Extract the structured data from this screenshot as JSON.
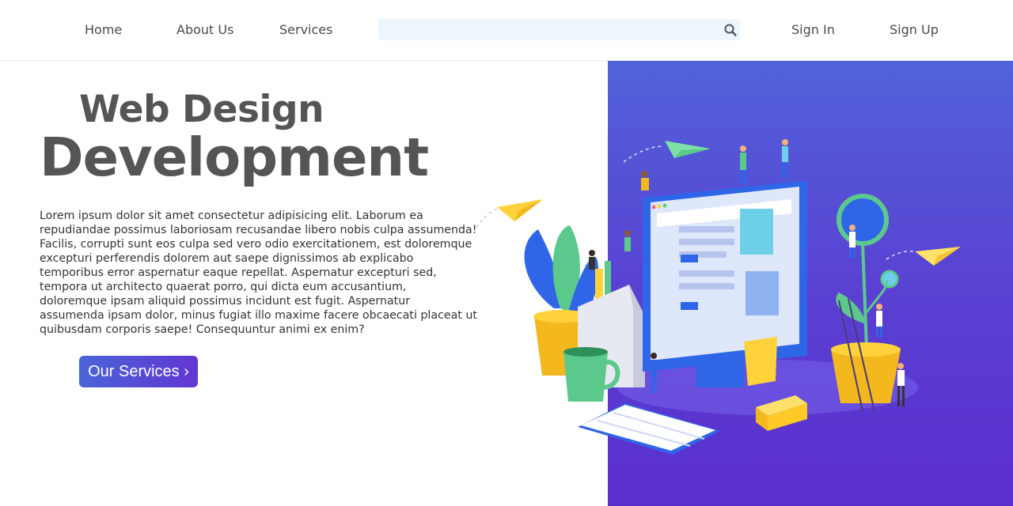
{
  "nav": {
    "home": "Home",
    "about": "About Us",
    "services": "Services",
    "sign_in": "Sign In",
    "sign_up": "Sign Up"
  },
  "search": {
    "value": "",
    "icon": "search-icon"
  },
  "hero": {
    "title_line1": "Web Design",
    "title_line2": "Development",
    "body": "Lorem ipsum dolor sit amet consectetur adipisicing elit. Laborum ea repudiandae possimus laboriosam recusandae libero nobis culpa assumenda! Facilis, corrupti sunt eos culpa sed vero odio exercitationem, est doloremque excepturi perferendis dolorem aut saepe dignissimos ab explicabo temporibus error aspernatur eaque repellat. Aspernatur excepturi sed, tempora ut architecto quaerat porro, qui dicta eum accusantium, doloremque ipsam aliquid possimus incidunt est fugit. Aspernatur assumenda ipsam dolor, minus fugiat illo maxime facere obcaecati placeat ut quibusdam corporis saepe! Consequuntur animi ex enim?",
    "cta": "Our Services ›"
  },
  "colors": {
    "panel_top": "#5162d9",
    "panel_bottom": "#5b2fcd",
    "button_start": "#4a64d8",
    "button_end": "#6236d0",
    "text": "#555555"
  }
}
